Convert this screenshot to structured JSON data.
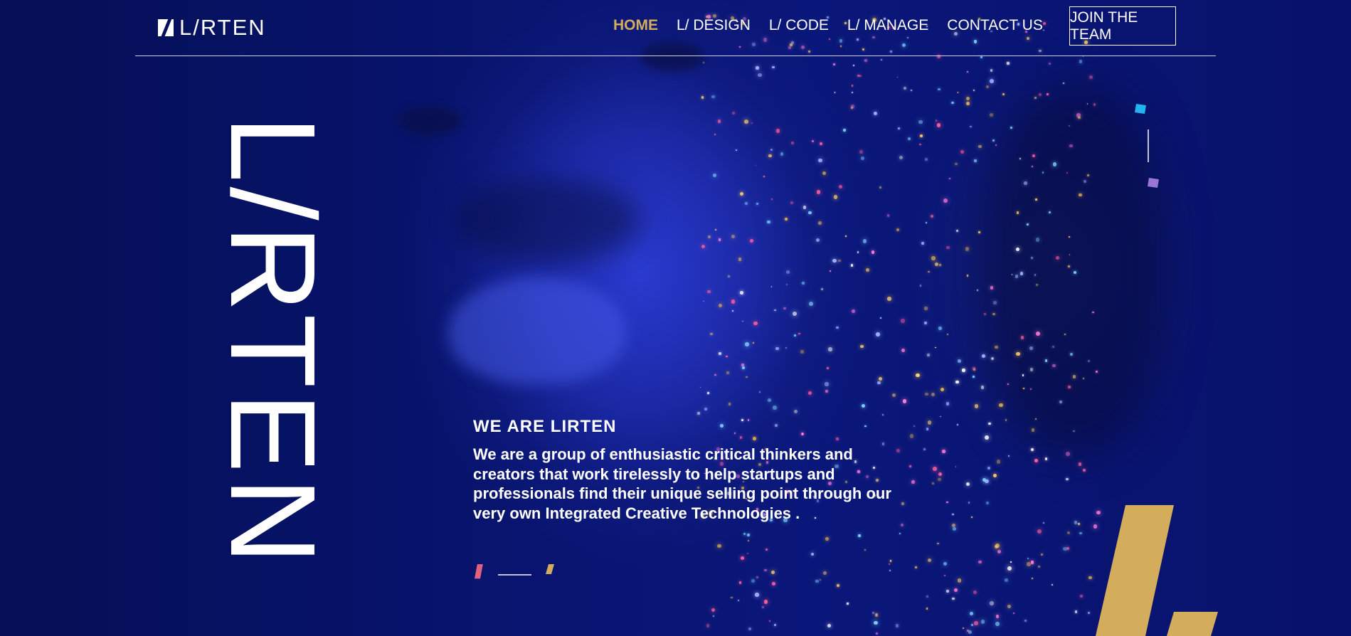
{
  "header": {
    "logo_text": "L/RTEN",
    "nav": [
      {
        "label": "HOME",
        "active": true
      },
      {
        "label": "L/ DESIGN",
        "active": false
      },
      {
        "label": "L/ CODE",
        "active": false
      },
      {
        "label": "L/ MANAGE",
        "active": false
      },
      {
        "label": "CONTACT US",
        "active": false
      }
    ],
    "join_button": "JOIN THE TEAM"
  },
  "hero": {
    "vertical_title": "L/RTEN",
    "kicker": "WE ARE LIRTEN",
    "description": "We are a group of enthusiastic critical thinkers and creators that work tirelessly to help startups and professionals find their unique selling point through our very own Integrated Creative Technologies ."
  },
  "colors": {
    "background": "#05105c",
    "accent_gold": "#d4ad5c",
    "accent_pink": "#e0607e",
    "accent_cyan": "#1fb6f0",
    "accent_violet": "#9a76d6"
  }
}
